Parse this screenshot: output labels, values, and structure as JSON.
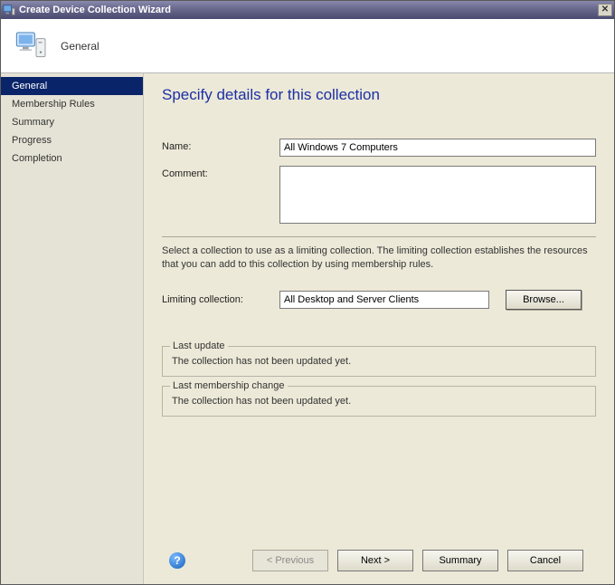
{
  "window": {
    "title": "Create Device Collection Wizard"
  },
  "header": {
    "stepTitle": "General"
  },
  "sidebar": {
    "items": [
      {
        "label": "General",
        "selected": true
      },
      {
        "label": "Membership Rules",
        "selected": false
      },
      {
        "label": "Summary",
        "selected": false
      },
      {
        "label": "Progress",
        "selected": false
      },
      {
        "label": "Completion",
        "selected": false
      }
    ]
  },
  "main": {
    "heading": "Specify details for this collection",
    "nameLabel": "Name:",
    "nameValue": "All Windows 7 Computers",
    "commentLabel": "Comment:",
    "commentValue": "",
    "limitingHelp": "Select a collection to use as a limiting collection. The limiting collection establishes the resources that you can add to this collection by using membership rules.",
    "limitingLabel": "Limiting collection:",
    "limitingValue": "All Desktop and Server Clients",
    "browseLabel": "Browse...",
    "lastUpdate": {
      "legend": "Last update",
      "text": "The collection has not been updated yet."
    },
    "lastMembership": {
      "legend": "Last membership change",
      "text": "The collection has not been updated yet."
    }
  },
  "footer": {
    "previous": "< Previous",
    "next": "Next >",
    "summary": "Summary",
    "cancel": "Cancel"
  }
}
